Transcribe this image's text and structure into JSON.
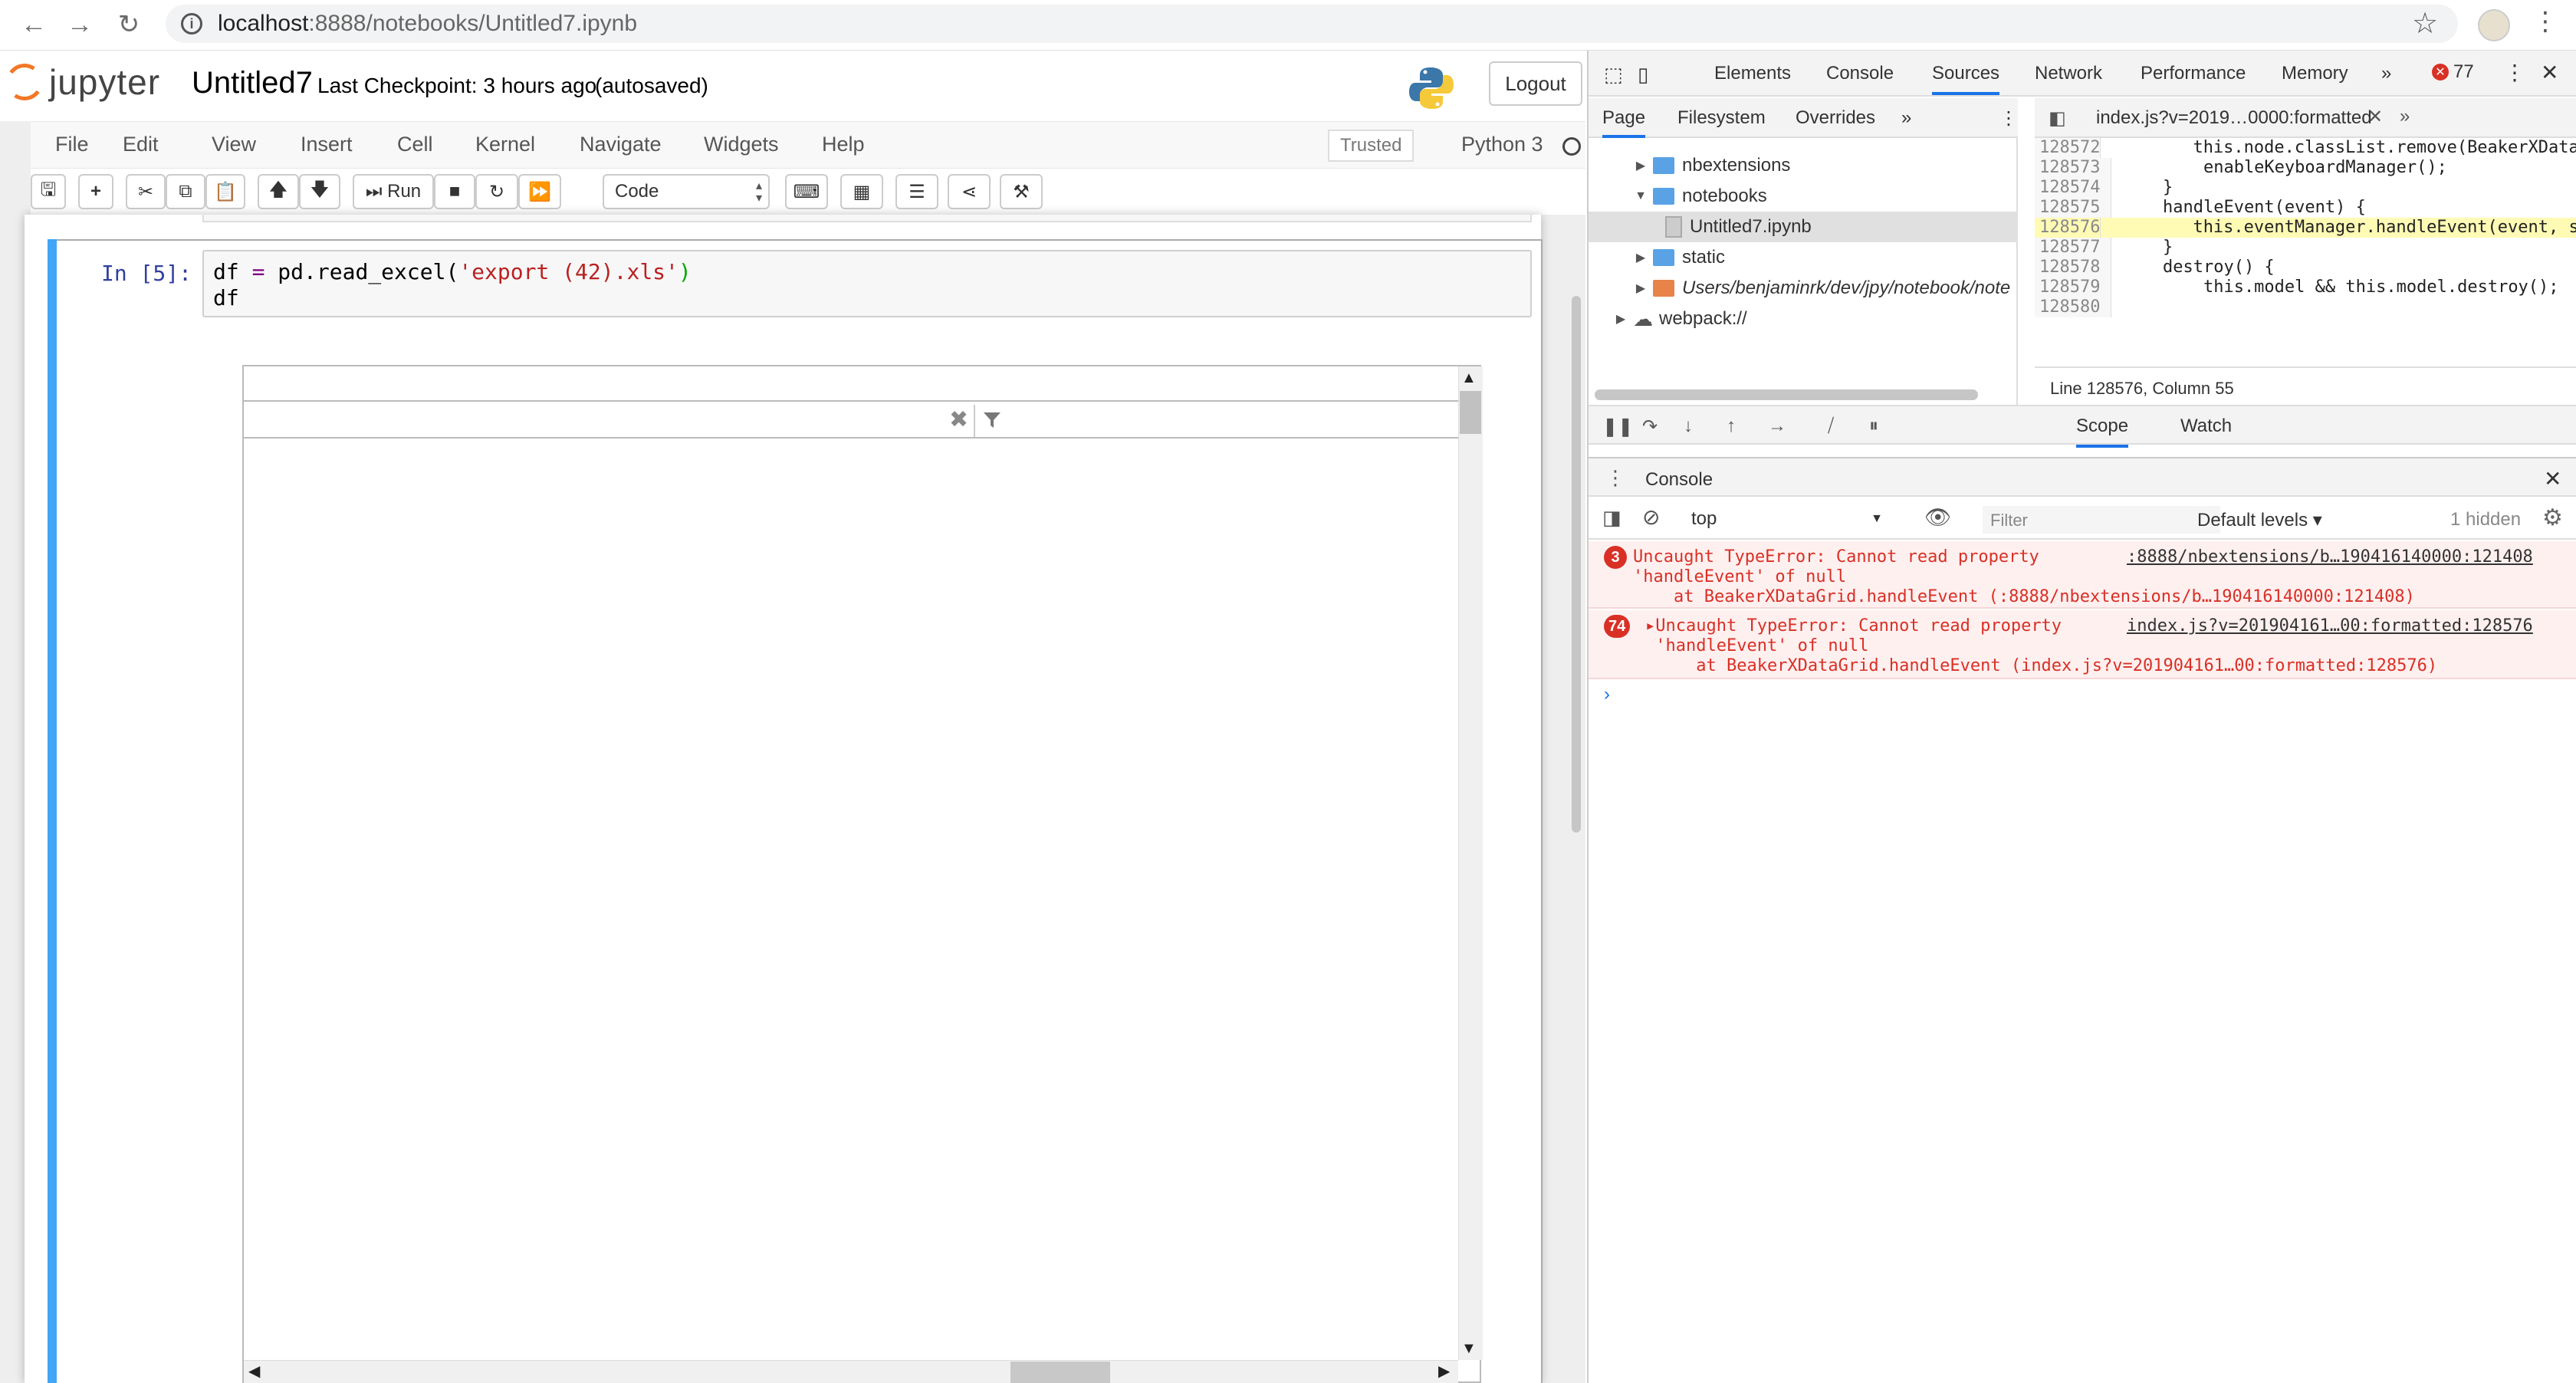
{
  "browser": {
    "url_host": "localhost",
    "url_path": ":8888/notebooks/Untitled7.ipynb"
  },
  "jupyter": {
    "logo_text": "jupyter",
    "notebook_title": "Untitled7",
    "checkpoint": "Last Checkpoint: 3 hours ago",
    "autosave": "(autosaved)",
    "logout": "Logout",
    "menu": [
      "File",
      "Edit",
      "View",
      "Insert",
      "Cell",
      "Kernel",
      "Navigate",
      "Widgets",
      "Help"
    ],
    "trusted": "Trusted",
    "kernel": "Python 3",
    "toolbar": {
      "run": "Run",
      "cell_type": "Code"
    },
    "cell": {
      "prompt": "In [5]:",
      "code_line1_a": "df ",
      "code_line1_op": "=",
      "code_line1_b": " pd.read_excel(",
      "code_line1_str": "'export (42).xls'",
      "code_line1_c": ")",
      "code_line2": "df"
    }
  },
  "devtools": {
    "tabs": [
      "Elements",
      "Console",
      "Sources",
      "Network",
      "Performance",
      "Memory"
    ],
    "error_count": "77",
    "nav_tabs": [
      "Page",
      "Filesystem",
      "Overrides"
    ],
    "tree": [
      {
        "label": "nbextensions",
        "type": "folder",
        "expanded": false
      },
      {
        "label": "notebooks",
        "type": "folder",
        "expanded": true
      },
      {
        "label": "Untitled7.ipynb",
        "type": "file",
        "selected": true
      },
      {
        "label": "static",
        "type": "folder",
        "expanded": false
      },
      {
        "label": "Users/benjaminrk/dev/jpy/notebook/note",
        "type": "folder-orange",
        "expanded": false
      },
      {
        "label": "webpack://",
        "type": "cloud",
        "expanded": false
      }
    ],
    "editor_tab": "index.js?v=2019…0000:formatted",
    "code_lines": [
      {
        "n": "128572",
        "t": "        this.node.classList.remove(BeakerXData"
      },
      {
        "n": "128573",
        "t": "        enableKeyboardManager();"
      },
      {
        "n": "128574",
        "t": "    }"
      },
      {
        "n": "128575",
        "t": "    handleEvent(event) {"
      },
      {
        "n": "128576",
        "t": "        this.eventManager.handleEvent(event, s"
      },
      {
        "n": "128577",
        "t": "    }"
      },
      {
        "n": "128578",
        "t": "    destroy() {"
      },
      {
        "n": "128579",
        "t": "        this.model && this.model.destroy();"
      },
      {
        "n": "128580",
        "t": ""
      }
    ],
    "status_line": "Line 128576, Column 55",
    "scope_tab": "Scope",
    "watch_tab": "Watch",
    "drawer_title": "Console",
    "context": "top",
    "filter_placeholder": "Filter",
    "levels": "Default levels ▾",
    "hidden": "1 hidden",
    "errors": [
      {
        "count": "3",
        "line1": "Uncaught TypeError: Cannot read property",
        "line2": "'handleEvent' of null",
        "line3": "    at BeakerXDataGrid.handleEvent (:8888/nbextensions/b…190416140000:121408)",
        "source": ":8888/nbextensions/b…190416140000:121408"
      },
      {
        "count": "74",
        "line1": "▸Uncaught TypeError: Cannot read property",
        "line2": " 'handleEvent' of null",
        "line3": "     at BeakerXDataGrid.handleEvent (index.js?v=201904161…00:formatted:128576)",
        "source": "index.js?v=201904161…00:formatted:128576"
      }
    ],
    "prompt": "›"
  }
}
